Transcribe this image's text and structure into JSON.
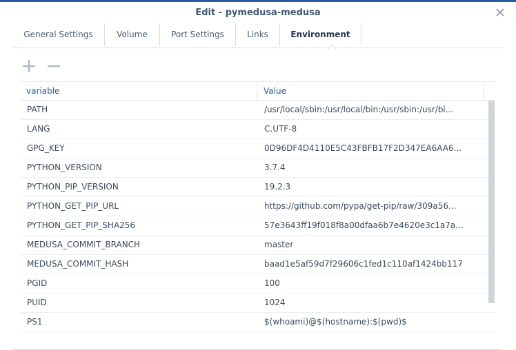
{
  "window": {
    "title": "Edit - pymedusa-medusa"
  },
  "tabs": [
    {
      "label": "General Settings"
    },
    {
      "label": "Volume"
    },
    {
      "label": "Port Settings"
    },
    {
      "label": "Links"
    },
    {
      "label": "Environment",
      "active": true
    }
  ],
  "toolbar": {
    "add_icon": "plus-icon",
    "remove_icon": "minus-icon"
  },
  "table": {
    "columns": [
      "variable",
      "Value"
    ],
    "rows": [
      {
        "variable": "PATH",
        "value": "/usr/local/sbin:/usr/local/bin:/usr/sbin:/usr/bi..."
      },
      {
        "variable": "LANG",
        "value": "C.UTF-8"
      },
      {
        "variable": "GPG_KEY",
        "value": "0D96DF4D4110E5C43FBFB17F2D347EA6AA6..."
      },
      {
        "variable": "PYTHON_VERSION",
        "value": "3.7.4"
      },
      {
        "variable": "PYTHON_PIP_VERSION",
        "value": "19.2.3"
      },
      {
        "variable": "PYTHON_GET_PIP_URL",
        "value": "https://github.com/pypa/get-pip/raw/309a56..."
      },
      {
        "variable": "PYTHON_GET_PIP_SHA256",
        "value": "57e3643ff19f018f8a00dfaa6b7e4620e3c1a7a..."
      },
      {
        "variable": "MEDUSA_COMMIT_BRANCH",
        "value": "master"
      },
      {
        "variable": "MEDUSA_COMMIT_HASH",
        "value": "baad1e5af59d7f29606c1fed1c110af1424bb117"
      },
      {
        "variable": "PGID",
        "value": "100"
      },
      {
        "variable": "PUID",
        "value": "1024"
      },
      {
        "variable": "PS1",
        "value": "$(whoami)@$(hostname):$(pwd)$"
      }
    ]
  },
  "colors": {
    "title_bar_accent": "#2a5b9c",
    "header_text": "#2d5a8e",
    "scrollbar": "#d0d5da"
  }
}
